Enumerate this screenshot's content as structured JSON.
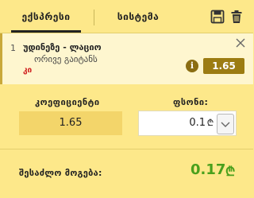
{
  "tabs": {
    "express_label": "ექსპრესი",
    "system_label": "სისტემა"
  },
  "bet": {
    "number": "1",
    "title": "უდინეზე - ლაციო",
    "market": "ორივე გაიტანს",
    "pick": "კი",
    "odds": "1.65"
  },
  "form": {
    "odds_label": "კოეფიციენტი",
    "odds_value": "1.65",
    "stake_label": "ფსონი:",
    "stake_value": "0.1",
    "currency_symbol": "₾"
  },
  "summary": {
    "win_label": "შესაძლო მოგება:",
    "win_value": "0.17",
    "currency_symbol": "₾"
  },
  "colors": {
    "background": "#fde88a",
    "card": "#fef6cf",
    "odds_badge": "#9c7c12",
    "pick_red": "#d0201f",
    "win_green": "#49a01c"
  },
  "icons": {
    "save": "save-icon",
    "trash": "trash-icon",
    "close": "close-icon",
    "info": "info-icon",
    "dropdown": "chevron-down-icon"
  }
}
